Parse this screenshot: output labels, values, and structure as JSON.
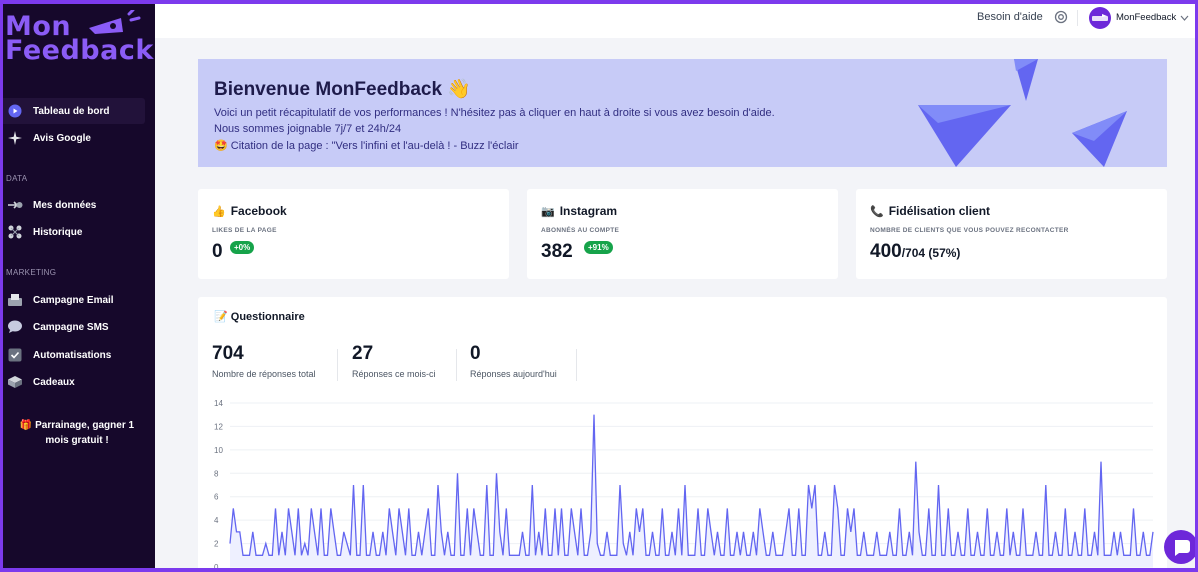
{
  "sidebar": {
    "logo": {
      "line1": "Mon",
      "line2": "Feedback"
    },
    "items": [
      {
        "label": "Tableau de bord",
        "icon": "dashboard-icon",
        "active": true
      },
      {
        "label": "Avis Google",
        "icon": "sparkle-icon",
        "active": false
      }
    ],
    "section_data": "DATA",
    "data_items": [
      {
        "label": "Mes données",
        "icon": "data-arrow-icon"
      },
      {
        "label": "Historique",
        "icon": "history-icon"
      }
    ],
    "section_marketing": "MARKETING",
    "marketing_items": [
      {
        "label": "Campagne Email",
        "icon": "inbox-icon"
      },
      {
        "label": "Campagne SMS",
        "icon": "speech-bubble-icon"
      },
      {
        "label": "Automatisations",
        "icon": "checkbox-icon"
      },
      {
        "label": "Cadeaux",
        "icon": "gift-box-icon"
      }
    ],
    "referral": "🎁 Parrainage, gagner 1 mois gratuit !"
  },
  "topbar": {
    "help": "Besoin d'aide",
    "user": "MonFeedback"
  },
  "banner": {
    "title": "Bienvenue MonFeedback 👋",
    "line1": "Voici un petit récapitulatif de vos performances ! N'hésitez pas à cliquer en haut à droite si vous avez besoin d'aide.",
    "line2": "Nous sommes joignable 7j/7 et 24h/24",
    "line3": "🤩 Citation de la page : \"Vers l'infini et l'au-delà ! - Buzz l'éclair"
  },
  "cards": {
    "facebook": {
      "emoji": "👍",
      "title": "Facebook",
      "subtitle": "LIKES DE LA PAGE",
      "value": "0",
      "change": "+0%"
    },
    "instagram": {
      "emoji": "📷",
      "title": "Instagram",
      "subtitle": "ABONNÉS AU COMPTE",
      "value": "382",
      "change": "+91%"
    },
    "loyalty": {
      "emoji": "📞",
      "title": "Fidélisation client",
      "subtitle": "NOMBRE DE CLIENTS QUE VOUS POUVEZ RECONTACTER",
      "value": "400",
      "total": "/704 (57%)"
    }
  },
  "questionnaire": {
    "emoji": "📝",
    "title": "Questionnaire",
    "stats": [
      {
        "value": "704",
        "label": "Nombre de réponses total"
      },
      {
        "value": "27",
        "label": "Réponses ce mois-ci"
      },
      {
        "value": "0",
        "label": "Réponses aujourd'hui"
      }
    ]
  },
  "colors": {
    "accent": "#6d28d9",
    "line": "#6366f1",
    "sidebar": "#16082b",
    "banner": "#c7cbf7",
    "positive": "#16a34a"
  },
  "chart_data": {
    "type": "line",
    "ylim": [
      0,
      14
    ],
    "yticks": [
      0,
      2,
      4,
      6,
      8,
      10,
      12,
      14
    ],
    "grid": true,
    "series": [
      {
        "values": [
          2,
          5,
          3,
          3,
          1,
          1,
          1,
          3,
          1,
          1,
          1,
          2,
          1,
          1,
          5,
          1,
          3,
          1,
          5,
          3,
          1,
          5,
          1,
          2,
          1,
          5,
          3,
          1,
          5,
          1,
          1,
          5,
          3,
          1,
          1,
          3,
          2,
          1,
          7,
          1,
          1,
          7,
          1,
          1,
          3,
          1,
          1,
          3,
          1,
          5,
          3,
          1,
          5,
          3,
          1,
          5,
          1,
          1,
          3,
          1,
          3,
          5,
          1,
          1,
          7,
          3,
          1,
          3,
          1,
          1,
          8,
          1,
          1,
          5,
          1,
          5,
          3,
          1,
          1,
          7,
          1,
          1,
          8,
          3,
          1,
          5,
          1,
          1,
          1,
          1,
          3,
          1,
          1,
          7,
          1,
          3,
          1,
          5,
          1,
          1,
          5,
          1,
          5,
          1,
          1,
          5,
          3,
          1,
          5,
          1,
          1,
          3,
          13,
          2,
          1,
          1,
          3,
          1,
          1,
          1,
          7,
          2,
          1,
          3,
          1,
          5,
          3,
          5,
          1,
          1,
          3,
          1,
          1,
          5,
          1,
          1,
          3,
          1,
          5,
          1,
          7,
          1,
          1,
          1,
          5,
          1,
          1,
          5,
          3,
          1,
          3,
          1,
          1,
          5,
          1,
          1,
          3,
          1,
          3,
          1,
          1,
          3,
          1,
          5,
          3,
          1,
          1,
          3,
          1,
          1,
          1,
          3,
          5,
          1,
          1,
          5,
          1,
          1,
          7,
          5,
          7,
          1,
          1,
          3,
          1,
          1,
          7,
          5,
          1,
          1,
          5,
          3,
          5,
          1,
          1,
          3,
          1,
          1,
          1,
          3,
          1,
          1,
          1,
          3,
          1,
          1,
          5,
          1,
          1,
          3,
          1,
          9,
          3,
          1,
          1,
          5,
          1,
          1,
          7,
          1,
          1,
          5,
          1,
          1,
          3,
          1,
          1,
          5,
          1,
          1,
          3,
          1,
          1,
          5,
          1,
          1,
          3,
          1,
          1,
          5,
          1,
          3,
          1,
          1,
          5,
          1,
          1,
          1,
          3,
          1,
          1,
          7,
          1,
          1,
          3,
          1,
          1,
          5,
          1,
          1,
          3,
          1,
          1,
          5,
          1,
          1,
          3,
          1,
          9,
          1,
          1,
          1,
          3,
          1,
          3,
          1,
          1,
          1,
          5,
          1,
          1,
          3,
          1,
          1,
          3
        ]
      }
    ]
  }
}
